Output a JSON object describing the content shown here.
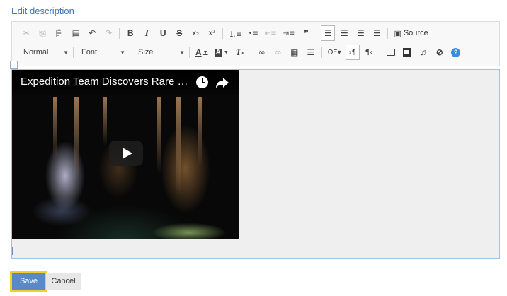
{
  "page": {
    "title": "Edit description"
  },
  "toolbar": {
    "source_label": "Source",
    "format_combo": "Normal",
    "font_combo": "Font",
    "size_combo": "Size",
    "icons": [
      "cut-icon",
      "copy-icon",
      "paste-icon",
      "paste-text-icon",
      "undo-icon",
      "redo-icon",
      "bold-icon",
      "italic-icon",
      "underline-icon",
      "strikethrough-icon",
      "subscript-icon",
      "superscript-icon",
      "numbered-list-icon",
      "bulleted-list-icon",
      "decrease-indent-icon",
      "increase-indent-icon",
      "blockquote-icon",
      "align-left-icon",
      "align-center-icon",
      "align-right-icon",
      "justify-icon",
      "source-icon",
      "text-color-icon",
      "background-color-icon",
      "remove-format-icon",
      "link-icon",
      "unlink-icon",
      "table-icon",
      "horizontal-rule-icon",
      "special-char-icon",
      "ltr-icon",
      "rtl-icon",
      "image-icon",
      "video-icon",
      "audio-icon",
      "attachment-icon",
      "help-icon"
    ]
  },
  "editor": {
    "video": {
      "title": "Expedition Team Discovers Rare Un..."
    }
  },
  "actions": {
    "save_label": "Save",
    "cancel_label": "Cancel"
  },
  "colors": {
    "title": "#3c78b5",
    "save_bg": "#5b88c6",
    "save_outline": "#f2cf2b",
    "editor_border": "#9ec3e6"
  }
}
